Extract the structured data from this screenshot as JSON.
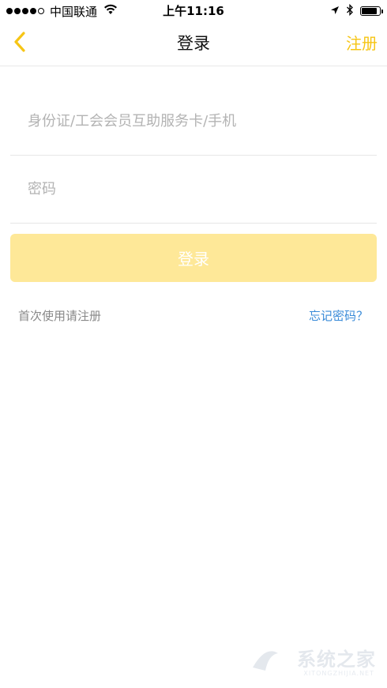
{
  "status_bar": {
    "carrier": "中国联通",
    "time": "上午11:16",
    "icons": [
      "signal-dots-icon",
      "wifi-icon",
      "location-arrow-icon",
      "bluetooth-icon",
      "battery-icon"
    ],
    "battery_level": 0.85
  },
  "nav": {
    "title": "登录",
    "back_icon": "chevron-left-icon",
    "register_label": "注册",
    "accent_color": "#f6c515"
  },
  "form": {
    "account_placeholder": "身份证/工会会员互助服务卡/手机",
    "account_value": "",
    "password_placeholder": "密码",
    "password_value": "",
    "login_label": "登录",
    "login_button_color": "#fee898"
  },
  "footer": {
    "first_use_text": "首次使用请注册",
    "forgot_password_label": "忘记密码？",
    "link_color": "#3a8bd8"
  },
  "watermark": {
    "text": "系统之家",
    "subtext": "XITONGZHIJIA.NET"
  }
}
